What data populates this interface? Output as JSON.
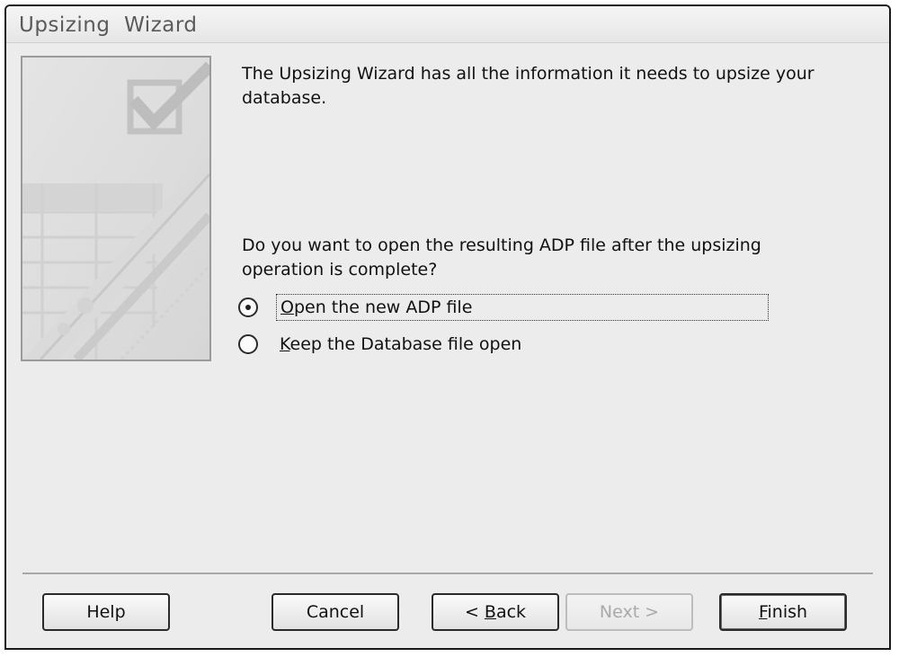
{
  "window": {
    "title": "Upsizing  Wizard"
  },
  "content": {
    "intro_text": "The Upsizing Wizard has all the information it needs to upsize your database.",
    "question_text": "Do you want to open the resulting ADP file after the upsizing operation is complete?",
    "options": [
      {
        "mnemonic": "O",
        "rest": "pen the new ADP file",
        "selected": true
      },
      {
        "mnemonic": "K",
        "rest": "eep the Database file open",
        "selected": false
      }
    ]
  },
  "buttons": {
    "help": "Help",
    "cancel": "Cancel",
    "back_prefix": "< ",
    "back_mnemonic": "B",
    "back_rest": "ack",
    "next": "Next >",
    "next_enabled": false,
    "finish_mnemonic": "F",
    "finish_rest": "inish"
  },
  "side_image": {
    "icon": "checkmark-checkbox-icon"
  }
}
